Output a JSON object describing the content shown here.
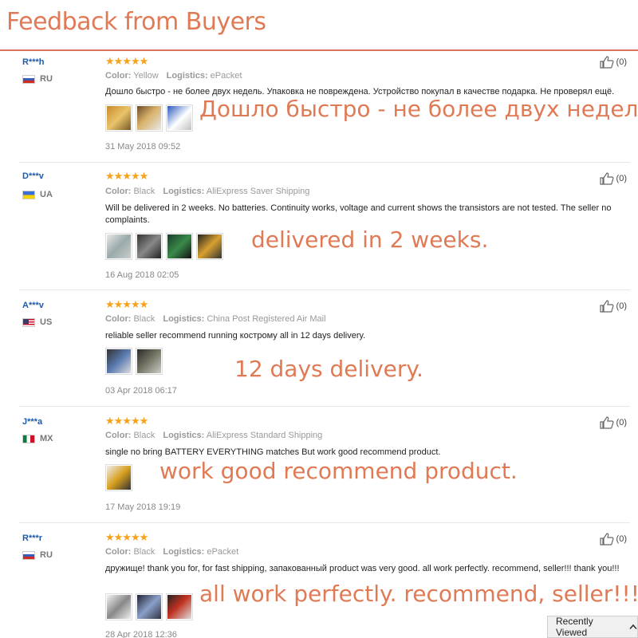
{
  "header": {
    "title": "Feedback from Buyers"
  },
  "reviews": [
    {
      "user": "R***h",
      "country": "RU",
      "stars": "★★★★★",
      "color_label": "Color:",
      "color": "Yellow",
      "logistics_label": "Logistics:",
      "logistics": "ePacket",
      "comment": "Дошло быстро - не более двух недель. Упаковка не повреждена. Устройство покупал в качестве подарка. Не проверял ещё.",
      "highlight": "Дошло быстро - не более двух недель.",
      "date": "31 May 2018 09:52",
      "likes": "(0)"
    },
    {
      "user": "D***v",
      "country": "UA",
      "stars": "★★★★★",
      "color_label": "Color:",
      "color": "Black",
      "logistics_label": "Logistics:",
      "logistics": "AliExpress Saver Shipping",
      "comment": "Will be delivered in 2 weeks. No batteries. Continuity works, voltage and current shows the transistors are not tested. The seller no complaints.",
      "highlight": "delivered in 2 weeks.",
      "date": "16 Aug 2018 02:05",
      "likes": "(0)"
    },
    {
      "user": "A***v",
      "country": "US",
      "stars": "★★★★★",
      "color_label": "Color:",
      "color": "Black",
      "logistics_label": "Logistics:",
      "logistics": "China Post Registered Air Mail",
      "comment": "reliable seller recommend running кострому all in 12 days delivery.",
      "highlight": "12 days delivery.",
      "date": "03 Apr 2018 06:17",
      "likes": "(0)"
    },
    {
      "user": "J***a",
      "country": "MX",
      "stars": "★★★★★",
      "color_label": "Color:",
      "color": "Black",
      "logistics_label": "Logistics:",
      "logistics": "AliExpress Standard Shipping",
      "comment": "single no bring BATTERY EVERYTHING matches But work good recommend product.",
      "highlight": "work good recommend product.",
      "date": "17 May 2018 19:19",
      "likes": "(0)"
    },
    {
      "user": "R***r",
      "country": "RU",
      "stars": "★★★★★",
      "color_label": "Color:",
      "color": "Black",
      "logistics_label": "Logistics:",
      "logistics": "ePacket",
      "comment": "дружище! thank you for, for fast shipping, запакованный product was very good. all work perfectly. recommend, seller!!! thank you!!!",
      "highlight": "all work perfectly. recommend, seller!!!",
      "date": "28 Apr 2018 12:36",
      "likes": "(0)"
    }
  ],
  "recently_viewed": {
    "label": "Recently Viewed",
    "icon": "chevron-up-icon"
  },
  "colors": {
    "accent": "#e07a55",
    "username": "#1f5aa8",
    "stars": "#f7a21b"
  }
}
